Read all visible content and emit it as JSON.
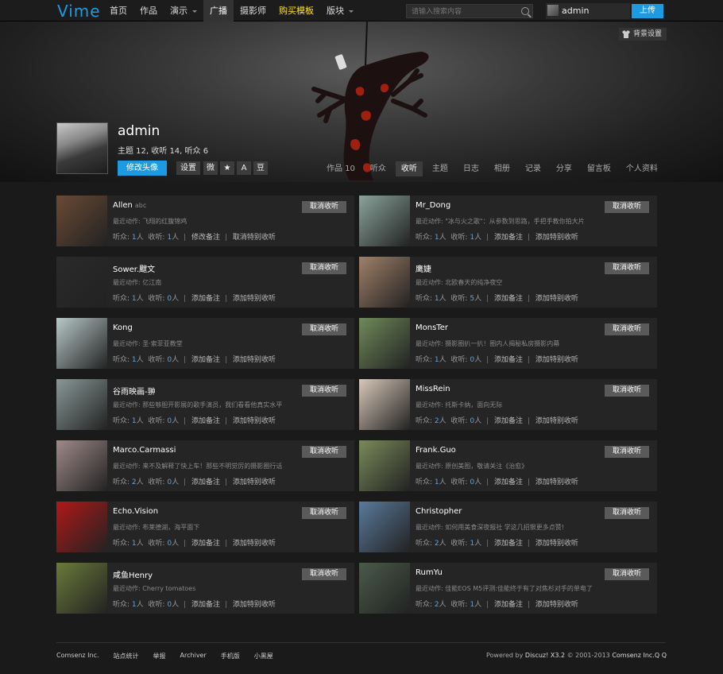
{
  "header": {
    "logo": "Vime",
    "nav": [
      {
        "label": "首页",
        "state": "normal"
      },
      {
        "label": "作品",
        "state": "normal"
      },
      {
        "label": "演示",
        "state": "dropdown"
      },
      {
        "label": "广播",
        "state": "active"
      },
      {
        "label": "摄影师",
        "state": "normal"
      },
      {
        "label": "购买模板",
        "state": "highlight"
      },
      {
        "label": "版块",
        "state": "dropdown"
      }
    ],
    "search_placeholder": "请输入搜索内容",
    "username": "admin",
    "upload_label": "上传"
  },
  "banner": {
    "bg_settings_label": "背景设置",
    "profile_name": "admin",
    "stats_text": "主题 12,  收听 14,  听众 6",
    "edit_avatar_label": "修改头像",
    "settings_label": "设置",
    "social": [
      "微",
      "★",
      "A",
      "豆"
    ],
    "tabs": [
      {
        "label": "作品 10",
        "active": false
      },
      {
        "label": "听众",
        "active": false
      },
      {
        "label": "收听",
        "active": true
      },
      {
        "label": "主题",
        "active": false
      },
      {
        "label": "日志",
        "active": false
      },
      {
        "label": "相册",
        "active": false
      },
      {
        "label": "记录",
        "active": false
      },
      {
        "label": "分享",
        "active": false
      },
      {
        "label": "留言板",
        "active": false
      },
      {
        "label": "个人资料",
        "active": false
      }
    ]
  },
  "labels": {
    "recent_prefix": "最近动作: ",
    "listeners": "听众:",
    "following": "收听:",
    "person": "人",
    "add_note": "添加备注",
    "edit_note": "修改备注",
    "special": "添加特别收听",
    "unspecial": "取消特别收听",
    "unfollow": "取消收听"
  },
  "cards": [
    {
      "name": "Allen",
      "tag": "abc",
      "recent": "飞翔的红腹锦鸡",
      "listeners": "1",
      "following": "1",
      "note": "修改备注",
      "special": "取消特别收听",
      "thumb": "#6a4a35"
    },
    {
      "name": "Mr_Dong",
      "tag": "",
      "recent": "\"冰与火之歌\"：从参数到思路，手把手教你拍大片",
      "listeners": "1",
      "following": "1",
      "note": "添加备注",
      "special": "添加特别收听",
      "thumb": "#8aa49a"
    },
    {
      "name": "Sower.颼文",
      "tag": "",
      "recent": "亿江南",
      "listeners": "1",
      "following": "0",
      "note": "添加备注",
      "special": "添加特别收听",
      "thumb": "#2a2a2a"
    },
    {
      "name": "鹰婕",
      "tag": "",
      "recent": "北欧春天的纯净夜空",
      "listeners": "1",
      "following": "5",
      "note": "添加备注",
      "special": "添加特别收听",
      "thumb": "#a08068"
    },
    {
      "name": "Kong",
      "tag": "",
      "recent": "圣·索菲亚教堂",
      "listeners": "1",
      "following": "0",
      "note": "添加备注",
      "special": "添加特别收听",
      "thumb": "#b8c8c8"
    },
    {
      "name": "MonsTer",
      "tag": "",
      "recent": "摄影圈扒一扒！圈内人揭秘私房摄影内幕",
      "listeners": "1",
      "following": "0",
      "note": "添加备注",
      "special": "添加特别收听",
      "thumb": "#6f8a5a"
    },
    {
      "name": "谷雨映画-翀",
      "tag": "",
      "recent": "那些够胆开影展的歌手演员，我们看看他真实水平",
      "listeners": "1",
      "following": "0",
      "note": "添加备注",
      "special": "添加特别收听",
      "thumb": "#8a9898"
    },
    {
      "name": "MissRein",
      "tag": "",
      "recent": "托斯卡纳，面向无际",
      "listeners": "2",
      "following": "0",
      "note": "添加备注",
      "special": "添加特别收听",
      "thumb": "#d8c8b8"
    },
    {
      "name": "Marco.Carmassi",
      "tag": "",
      "recent": "来不及解释了快上车！那些不明觉厉的摄影圈行话",
      "listeners": "2",
      "following": "0",
      "note": "添加备注",
      "special": "添加特别收听",
      "thumb": "#a08a8a"
    },
    {
      "name": "Frank.Guo",
      "tag": "",
      "recent": "原创美图，敬请关注《治愈》",
      "listeners": "1",
      "following": "0",
      "note": "添加备注",
      "special": "添加特别收听",
      "thumb": "#7a8a5a"
    },
    {
      "name": "Echo.Vision",
      "tag": "",
      "recent": "布莱德湖，海平面下",
      "listeners": "1",
      "following": "0",
      "note": "添加备注",
      "special": "添加特别收听",
      "thumb": "#b01818"
    },
    {
      "name": "Christopher",
      "tag": "",
      "recent": "如何用美食深夜报社 学这几招狠更多点赞!",
      "listeners": "2",
      "following": "1",
      "note": "添加备注",
      "special": "添加特别收听",
      "thumb": "#5a7a9a"
    },
    {
      "name": "咸鱼Henry",
      "tag": "",
      "recent": "Cherry tomatoes",
      "listeners": "1",
      "following": "0",
      "note": "添加备注",
      "special": "添加特别收听",
      "thumb": "#6a7a3a"
    },
    {
      "name": "RumYu",
      "tag": "",
      "recent": "佳能EOS M5评测:佳能终于有了对焦杉对手的单电了",
      "listeners": "2",
      "following": "1",
      "note": "添加备注",
      "special": "添加特别收听",
      "thumb": "#4a5a4a"
    }
  ],
  "footer": {
    "links": [
      "Comsenz Inc.",
      "站点统计",
      "举报",
      "Archiver",
      "手机版",
      "小黑屋"
    ],
    "powered": "Powered by ",
    "discuz": "Discuz! X3.2",
    "copyright": " © 2001-2013 ",
    "company": "Comsenz Inc.Q Q"
  }
}
